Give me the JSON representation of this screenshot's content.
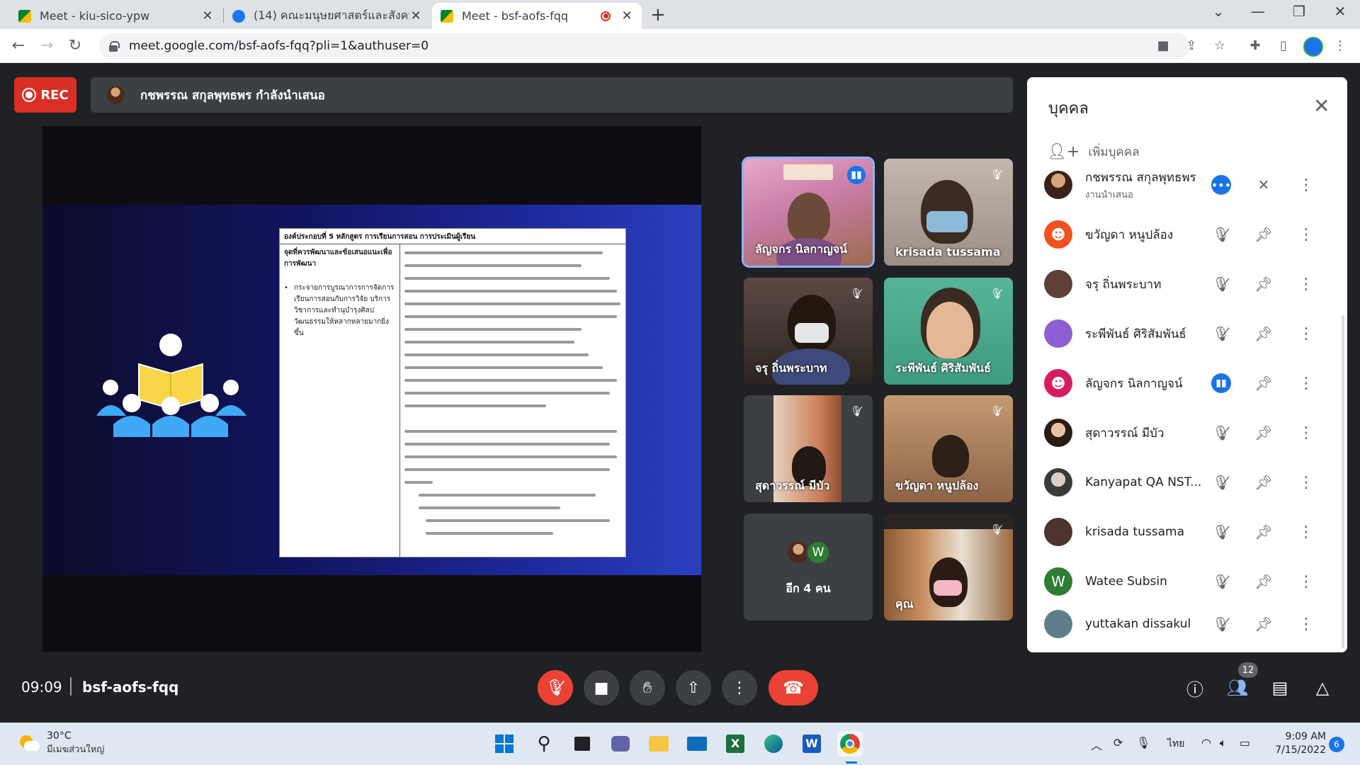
{
  "browser": {
    "tabs": [
      {
        "title": "Meet - kiu-sico-ypw",
        "favicon": "google-meet-icon"
      },
      {
        "title": "(14) คณะมนุษยศาสตร์และสังคมศาสต",
        "favicon": "facebook-icon"
      },
      {
        "title": "Meet - bsf-aofs-fqq",
        "favicon": "google-meet-icon",
        "recording": true
      }
    ],
    "url": "meet.google.com/bsf-aofs-fqq?pli=1&authuser=0"
  },
  "meet": {
    "rec_label": "REC",
    "presenting_text": "กชพรรณ สกุลพุทธพร กำลังนำเสนอ",
    "slide": {
      "header": "องค์ประกอบที่ 5 หลักสูตร การเรียนการสอน การประเมินผู้เรียน",
      "left_title": "จุดที่ควรพัฒนาและข้อเสนอแนะเพื่อการพัฒนา",
      "left_bullet": "กระจายการบูรณาการการจัดการเรียนการสอนกับการวิจัย บริการวิชาการและทำนุบำรุงศิลปวัฒนธรรมให้หลากหลายมากยิ่งขึ้น"
    },
    "tiles": [
      {
        "name": "ลัญจกร นิลกาญจน์",
        "speaking": true
      },
      {
        "name": "krisada tussama",
        "speaking": false
      },
      {
        "name": "จรุ ถิ่นพระบาท",
        "speaking": false
      },
      {
        "name": "ระพีพันธ์ ศิริสัมพันธ์",
        "speaking": false
      },
      {
        "name": "สุดาวรรณ์ มีบัว",
        "speaking": false
      },
      {
        "name": "ขวัญดา หนูปล้อง",
        "speaking": false
      },
      {
        "name": "อีก 4 คน",
        "avatar_letter": "W"
      },
      {
        "name": "คุณ",
        "speaking": false
      }
    ],
    "people_panel": {
      "title": "บุคคล",
      "add_people": "เพิ่มบุคคล",
      "people": [
        {
          "name": "กชพรรณ สกุลพุทธพร",
          "role": "งานนำเสนอ",
          "avatar_color": "#6d4c41",
          "mic": "dots"
        },
        {
          "name": "ขวัญดา หนูปล้อง",
          "avatar_color": "#f4511e",
          "mic": "muted"
        },
        {
          "name": "จรุ ถิ่นพระบาท",
          "avatar_color": "#5d4037",
          "mic": "muted"
        },
        {
          "name": "ระพีพันธ์ ศิริสัมพันธ์",
          "avatar_color": "#8e5fd3",
          "mic": "muted"
        },
        {
          "name": "ลัญจกร นิลกาญจน์",
          "avatar_color": "#d81b60",
          "mic": "speaking"
        },
        {
          "name": "สุดาวรรณ์ มีบัว",
          "avatar_color": "#c78b6a",
          "mic": "muted"
        },
        {
          "name": "Kanyapat QA NST...",
          "avatar_color": "#424242",
          "mic": "muted"
        },
        {
          "name": "krisada tussama",
          "avatar_color": "#4e342e",
          "mic": "muted"
        },
        {
          "name": "Watee Subsin",
          "avatar_color": "#2e7d32",
          "avatar_letter": "W",
          "mic": "muted"
        },
        {
          "name": "yuttakan dissakul",
          "avatar_color": "#607d8b",
          "mic": "muted"
        }
      ]
    },
    "bottom": {
      "time": "09:09",
      "meeting_code": "bsf-aofs-fqq",
      "people_count": "12"
    }
  },
  "taskbar": {
    "weather_temp": "30°C",
    "weather_desc": "มีเมฆส่วนใหญ่",
    "language": "ไทย",
    "time": "9:09 AM",
    "date": "7/15/2022",
    "notifications": "6"
  }
}
